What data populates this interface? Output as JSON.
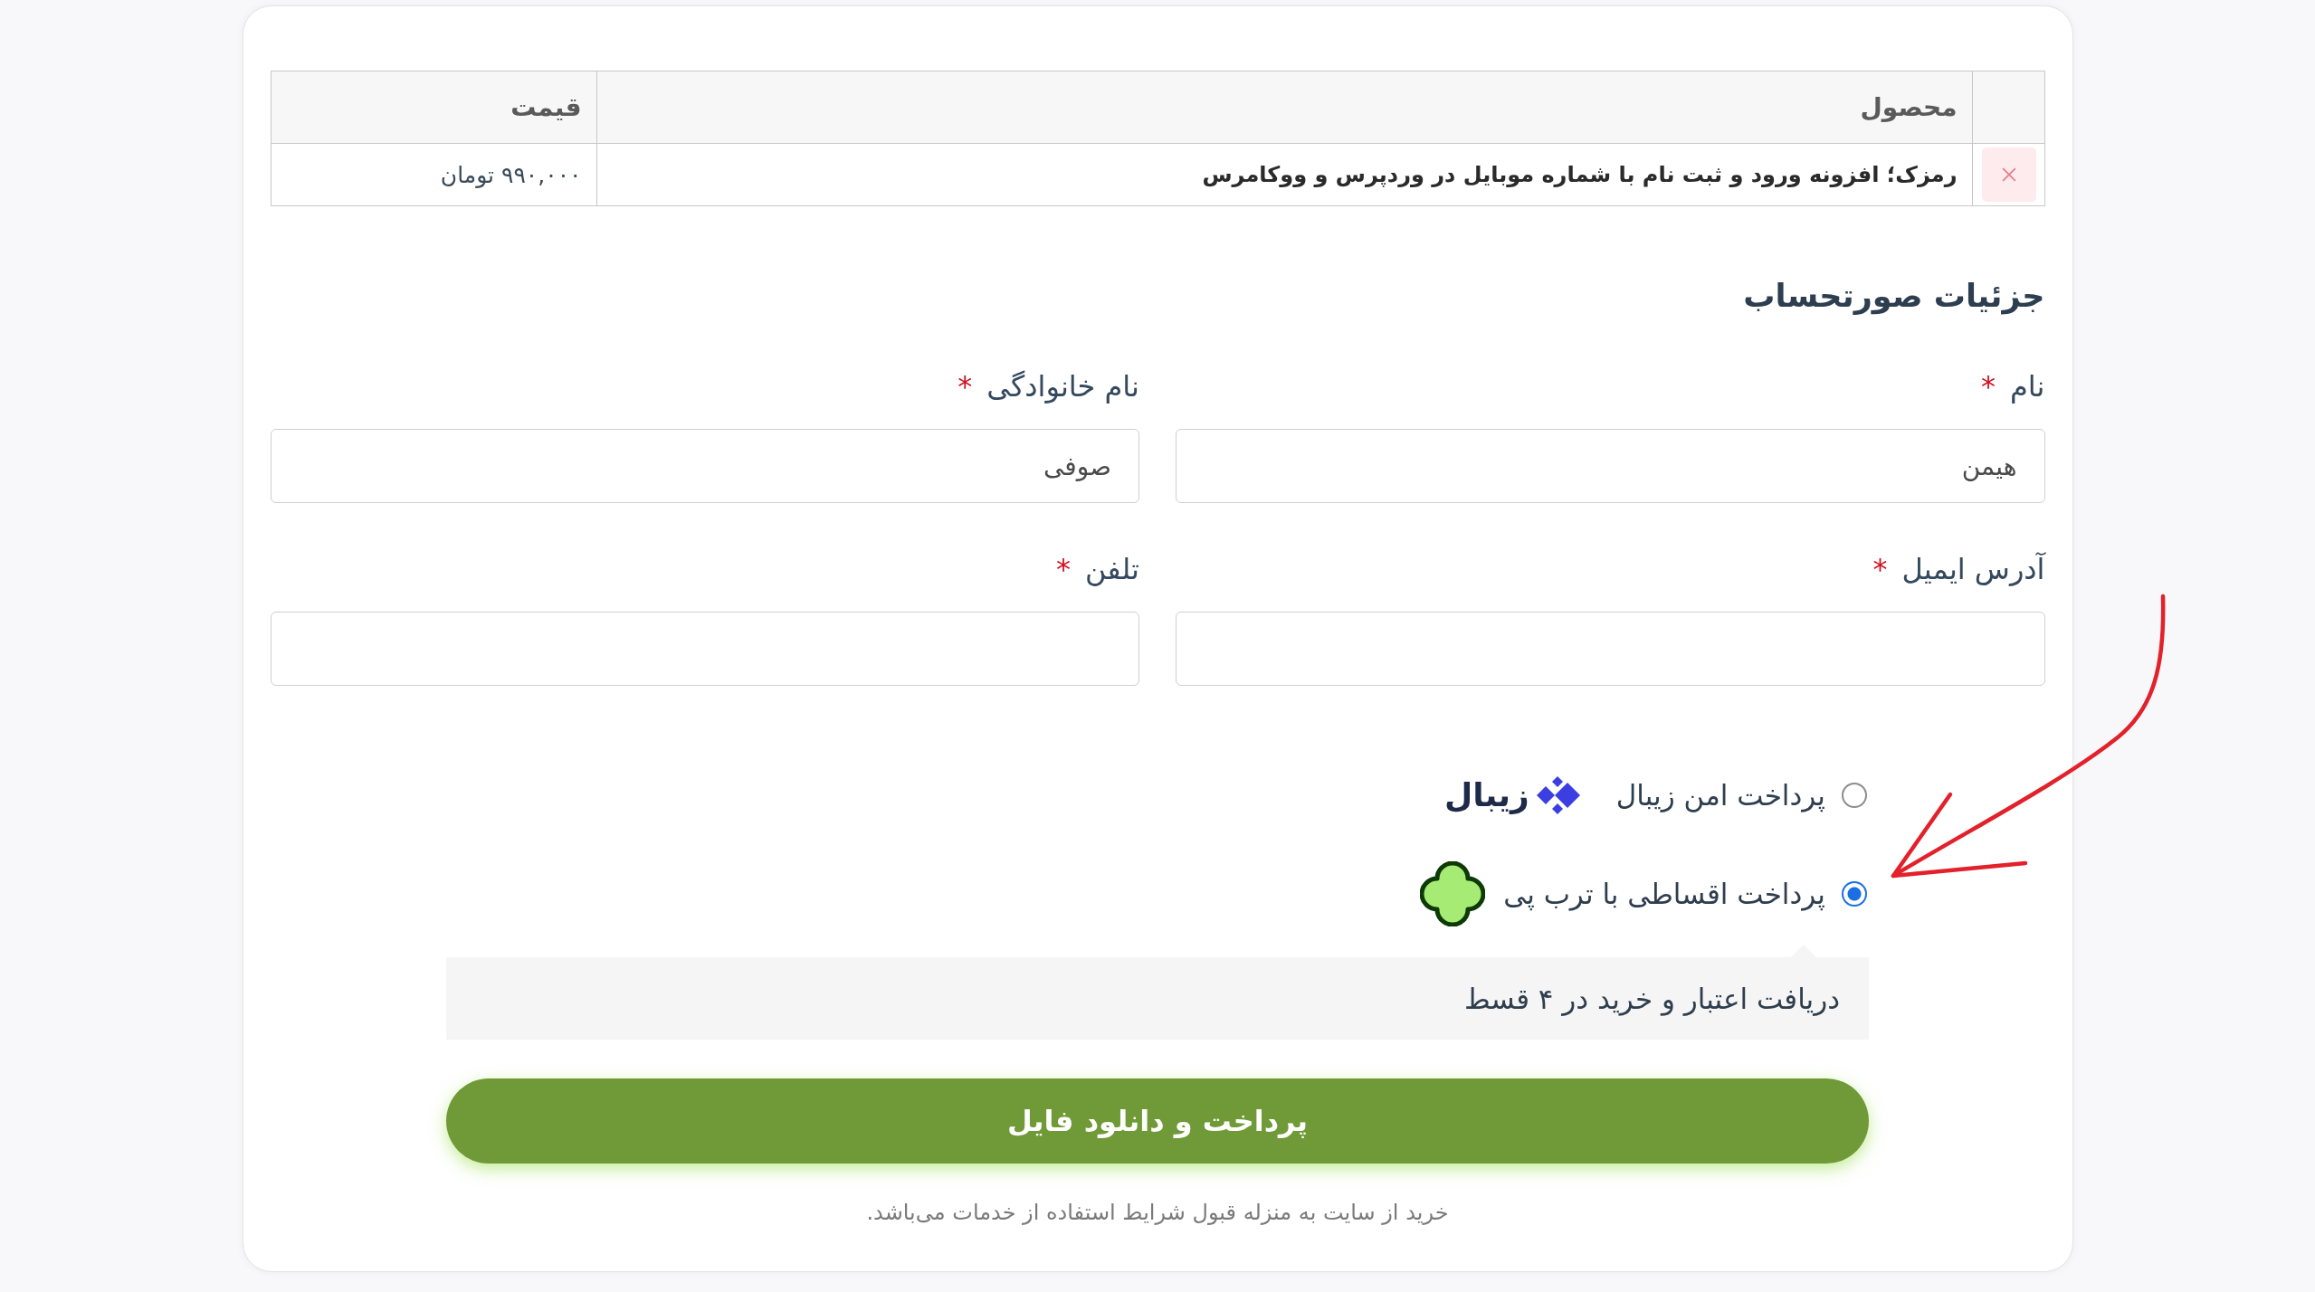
{
  "cart_table": {
    "columns": [
      "محصول",
      "قیمت"
    ],
    "rows": [
      {
        "product": "رمزک؛ افزونه ورود و ثبت نام با شماره موبایل در وردپرس و ووکامرس",
        "price": "۹۹۰,۰۰۰ تومان"
      }
    ]
  },
  "billing": {
    "title": "جزئیات صورتحساب",
    "fields": [
      {
        "label": "نام",
        "required_mark": "*",
        "value": "هیمن"
      },
      {
        "label": "نام خانوادگی",
        "required_mark": "*",
        "value": "صوفی"
      },
      {
        "label": "آدرس ایمیل",
        "required_mark": "*"
      },
      {
        "label": "تلفن",
        "required_mark": "*"
      }
    ]
  },
  "payment_methods": [
    {
      "kind": "zibal",
      "label": "پرداخت امن زیبال",
      "selected": false,
      "logo_text": "زیبال"
    },
    {
      "kind": "torobpay",
      "label": "پرداخت اقساطی با ترب پی",
      "selected": true,
      "description": "دریافت اعتبار و خرید در ۴ قسط"
    }
  ],
  "submit_button": "پرداخت و دانلود فایل",
  "terms_note": "خرید از سایت به منزله قبول شرایط استفاده از خدمات می‌باشد."
}
